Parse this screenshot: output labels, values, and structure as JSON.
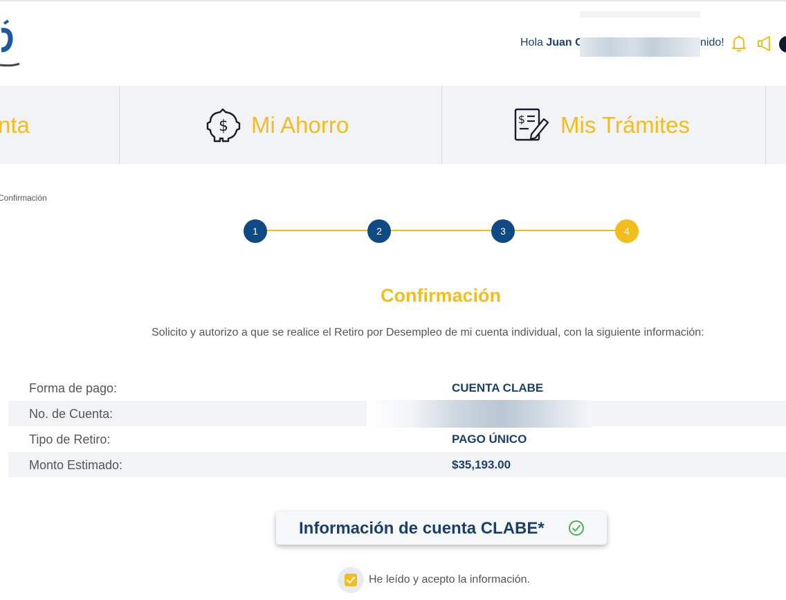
{
  "header": {
    "greeting_prefix": "Hola ",
    "user_name_visible": "Juan C",
    "greeting_suffix": "nido!"
  },
  "nav": {
    "items": [
      {
        "label": "nta",
        "icon": "wallet-icon"
      },
      {
        "label": "Mi Ahorro",
        "icon": "piggy-bank-icon"
      },
      {
        "label": "Mis Trámites",
        "icon": "document-edit-icon"
      }
    ]
  },
  "breadcrumb": {
    "current": "Confirmación"
  },
  "stepper": {
    "steps": [
      "1",
      "2",
      "3",
      "4"
    ],
    "active_step": 4
  },
  "main": {
    "title": "Confirmación",
    "intro": "Solicito y autorizo a que se realice el Retiro por Desempleo de mi cuenta individual, con la siguiente información:"
  },
  "details": {
    "rows": [
      {
        "label": "Forma de pago:",
        "value": "CUENTA CLABE"
      },
      {
        "label": "No. de Cuenta:",
        "value": ""
      },
      {
        "label": "Tipo de Retiro:",
        "value": "PAGO ÚNICO"
      },
      {
        "label": "Monto Estimado:",
        "value": "$35,193.00"
      }
    ]
  },
  "clabe_card": {
    "label": "Información de cuenta CLABE*"
  },
  "accept": {
    "label": "He leído y acepto la información.",
    "checked": true
  },
  "colors": {
    "accent_yellow": "#f2bd1d",
    "brand_blue": "#0f4a84",
    "text_navy": "#1b3f6b",
    "success_green": "#4caf50"
  }
}
